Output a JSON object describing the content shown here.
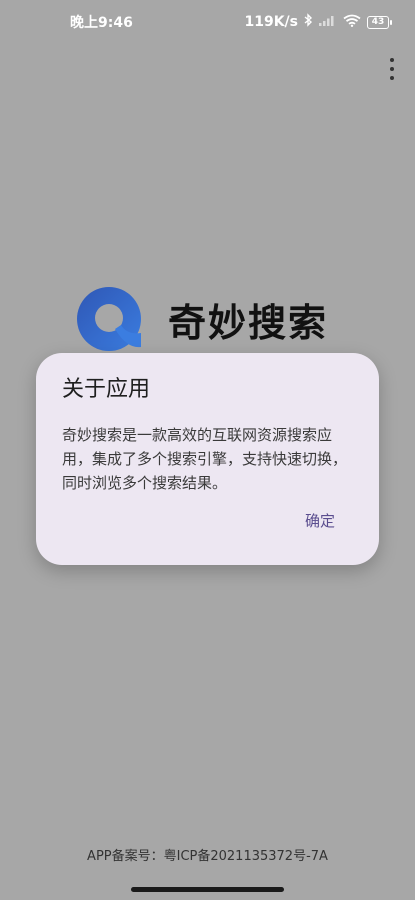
{
  "status_bar": {
    "time": "晚上9:46",
    "network_speed": "119K/s",
    "battery_level": "43",
    "icons": [
      "bluetooth-icon",
      "signal-icon",
      "wifi-icon",
      "battery-icon"
    ]
  },
  "app": {
    "name": "奇妙搜索",
    "logo_colors": [
      "#2f57b5",
      "#3b7de0"
    ]
  },
  "dialog": {
    "title": "关于应用",
    "body": "奇妙搜索是一款高效的互联网资源搜索应用，集成了多个搜索引擎，支持快速切换，同时浏览多个搜索结果。",
    "confirm_label": "确定"
  },
  "footer": {
    "icp": "APP备案号：粤ICP备2021135372号-7A"
  },
  "colors": {
    "scrim": "#a7a7a7",
    "dialog_bg": "#ede7f2",
    "accent": "#5a4d8f"
  }
}
